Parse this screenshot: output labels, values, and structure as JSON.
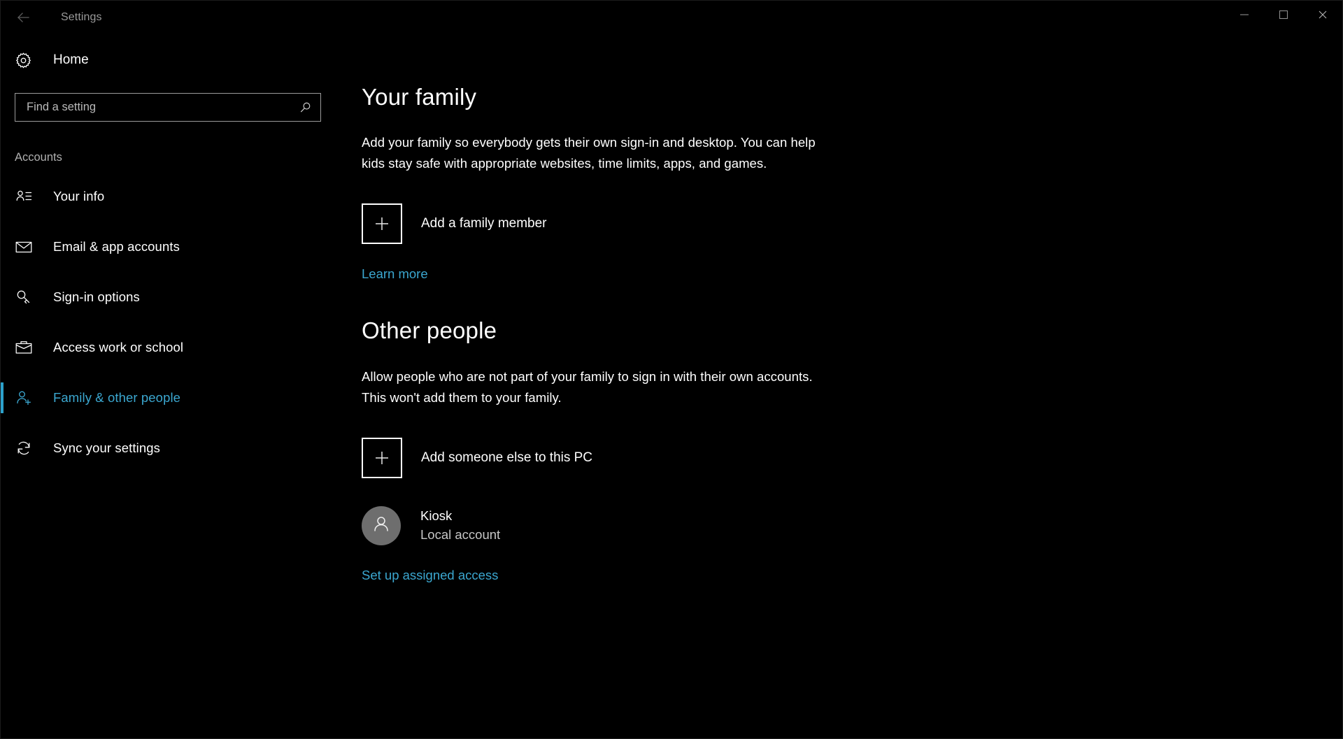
{
  "window": {
    "title": "Settings",
    "back_icon": "back-arrow-icon",
    "controls": [
      {
        "name": "minimize-button",
        "icon": "minimize-icon",
        "label": "Minimize"
      },
      {
        "name": "maximize-button",
        "icon": "maximize-icon",
        "label": "Maximize"
      },
      {
        "name": "close-button",
        "icon": "close-icon",
        "label": "Close"
      }
    ]
  },
  "colors": {
    "background": "#000000",
    "accent": "#3ba7d0",
    "accent_bar": "#2da2cc",
    "text": "#ffffff",
    "text_secondary": "#c6c6c6",
    "text_muted": "#9a9a9a",
    "avatar_bg": "#6e6e6e",
    "border": "#9b9b9b"
  },
  "sidebar": {
    "home": {
      "label": "Home",
      "icon": "gear-icon"
    },
    "search": {
      "value": "",
      "placeholder": "Find a setting",
      "icon": "search-icon"
    },
    "group_header": "Accounts",
    "items": [
      {
        "label": "Your info",
        "icon": "user-card-icon",
        "selected": false
      },
      {
        "label": "Email & app accounts",
        "icon": "envelope-icon",
        "selected": false
      },
      {
        "label": "Sign-in options",
        "icon": "key-icon",
        "selected": false
      },
      {
        "label": "Access work or school",
        "icon": "briefcase-icon",
        "selected": false
      },
      {
        "label": "Family & other people",
        "icon": "user-add-icon",
        "selected": true
      },
      {
        "label": "Sync your settings",
        "icon": "sync-icon",
        "selected": false
      }
    ]
  },
  "main": {
    "family": {
      "heading": "Your family",
      "description": "Add your family so everybody gets their own sign-in and desktop. You can help kids stay safe with appropriate websites, time limits, apps, and games.",
      "add_button": {
        "label": "Add a family member",
        "icon": "plus-icon"
      },
      "learn_more": "Learn more"
    },
    "other_people": {
      "heading": "Other people",
      "description": "Allow people who are not part of your family to sign in with their own accounts. This won't add them to your family.",
      "add_button": {
        "label": "Add someone else to this PC",
        "icon": "plus-icon"
      },
      "accounts": [
        {
          "name": "Kiosk",
          "type": "Local account",
          "avatar_icon": "person-avatar-icon"
        }
      ],
      "assigned_access_link": "Set up assigned access"
    }
  }
}
